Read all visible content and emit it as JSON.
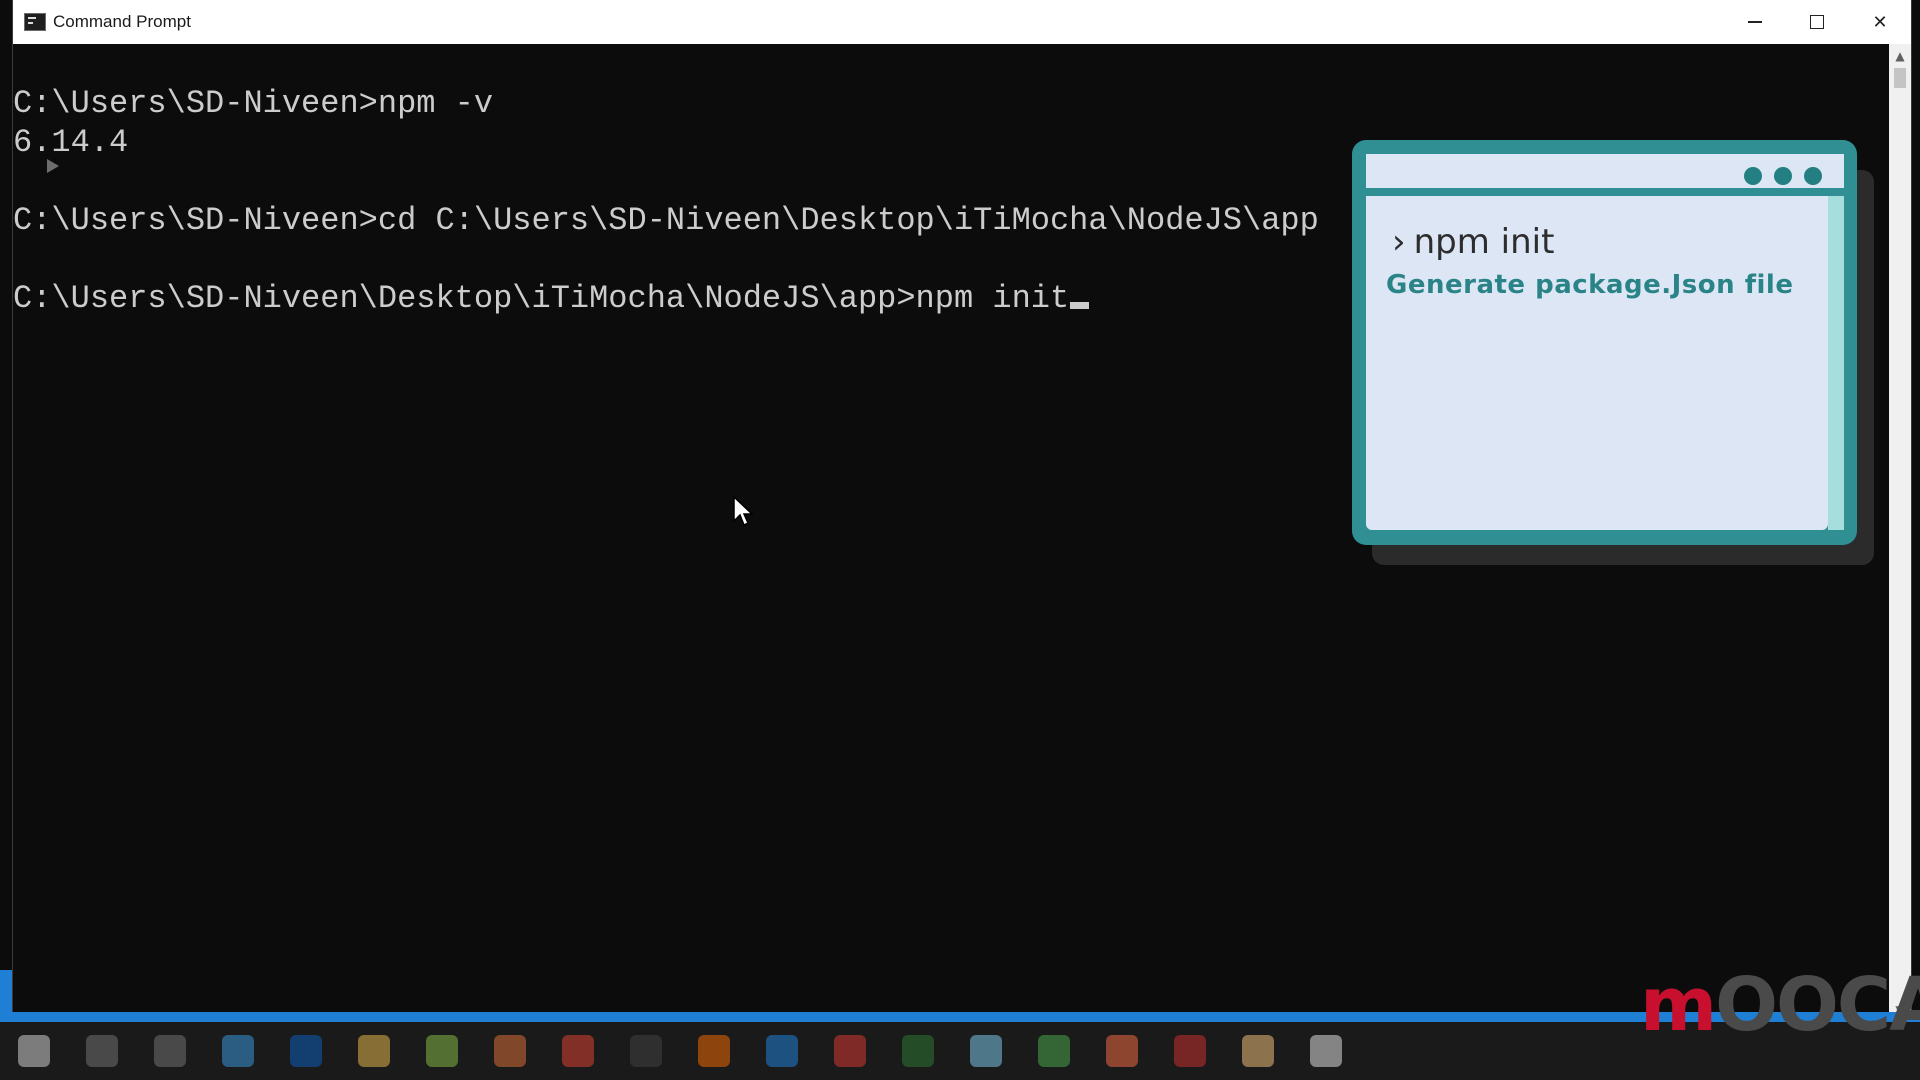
{
  "window": {
    "title": "Command Prompt",
    "controls": {
      "minimize": "–",
      "maximize": "□",
      "close": "✕"
    }
  },
  "console": {
    "lines": [
      "C:\\Users\\SD-Niveen>npm -v",
      "6.14.4",
      "C:\\Users\\SD-Niveen>cd C:\\Users\\SD-Niveen\\Desktop\\iTiMocha\\NodeJS\\app",
      "C:\\Users\\SD-Niveen\\Desktop\\iTiMocha\\NodeJS\\app>npm init"
    ]
  },
  "overlay": {
    "command": "npm init",
    "description": "Generate package.Json file"
  },
  "watermark": {
    "part1": "m",
    "part2": "OOCA"
  },
  "taskbar": {
    "icon_colors": [
      "#dddddd",
      "#777777",
      "#777777",
      "#3aa0e8",
      "#0a63c4",
      "#f2c14e",
      "#8bc34a",
      "#e8743b",
      "#e94335",
      "#444444",
      "#ff6f00",
      "#1e88e5",
      "#e53935",
      "#2e7d32",
      "#81d4fa",
      "#4caf50",
      "#ff7043",
      "#d32f2f",
      "#ffcc80",
      "#eeeeee"
    ]
  },
  "colors": {
    "accent": "#1e7fd4",
    "card": "#2f8f92",
    "card_bg": "#dce6f5"
  }
}
